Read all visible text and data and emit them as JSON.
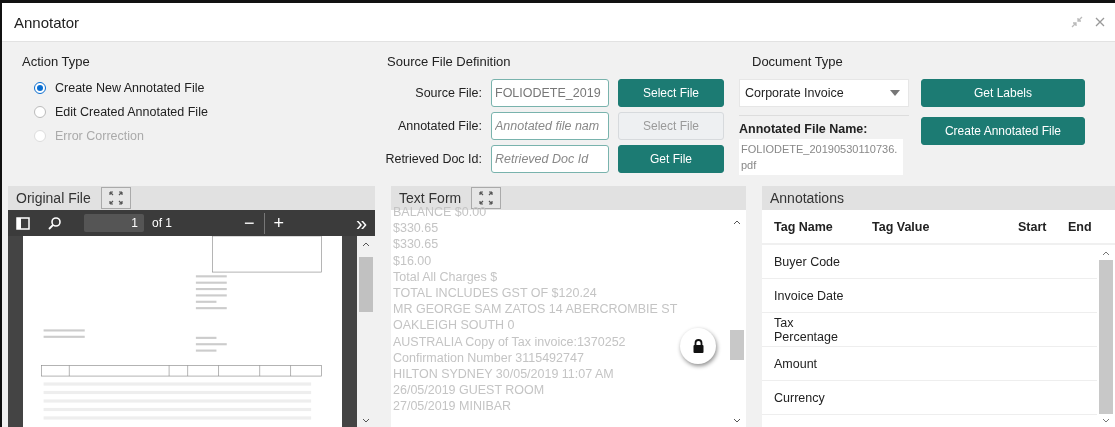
{
  "window": {
    "title": "Annotator"
  },
  "action_type": {
    "title": "Action Type",
    "options": [
      {
        "label": "Create New Annotated File",
        "selected": true,
        "disabled": false
      },
      {
        "label": "Edit Created Annotated File",
        "selected": false,
        "disabled": false
      },
      {
        "label": "Error Correction",
        "selected": false,
        "disabled": true
      }
    ]
  },
  "source_file_definition": {
    "title": "Source File Definition",
    "rows": [
      {
        "label": "Source File:",
        "value": "FOLIODETE_2019",
        "button": {
          "label": "Select File",
          "disabled": false
        }
      },
      {
        "label": "Annotated File:",
        "placeholder": "Annotated file nam",
        "button": {
          "label": "Select File",
          "disabled": true
        }
      },
      {
        "label": "Retrieved Doc Id:",
        "placeholder": "Retrieved Doc Id",
        "button": {
          "label": "Get File",
          "disabled": false
        }
      }
    ]
  },
  "document_type": {
    "title": "Document Type",
    "select": {
      "value": "Corporate Invoice"
    },
    "annotated_file_name": {
      "label": "Annotated File Name:",
      "value": "FOLIODETE_20190530110736.pdf"
    },
    "buttons": [
      "Get Labels",
      "Create Annotated File"
    ]
  },
  "original_file": {
    "title": "Original File",
    "page": "1",
    "page_count": "of 1",
    "zoom_out": "−",
    "zoom_in": "+",
    "more": "»"
  },
  "text_form": {
    "title": "Text Form",
    "lines": [
      "BALANCE $0.00",
      "$330.65",
      "$330.65",
      "$16.00",
      "Total All Charges $",
      "TOTAL INCLUDES GST OF $120.24",
      "MR GEORGE SAM ZATOS 14 ABERCROMBIE ST",
      "OAKLEIGH SOUTH 0",
      "AUSTRALIA Copy of Tax invoice:1370252",
      "Confirmation Number 3115492747",
      "HILTON SYDNEY 30/05/2019 11:07 AM",
      "26/05/2019 GUEST ROOM",
      "27/05/2019 MINIBAR"
    ]
  },
  "annotations": {
    "title": "Annotations",
    "columns": [
      "Tag Name",
      "Tag Value",
      "Start",
      "End"
    ],
    "rows": [
      "Buyer Code",
      "Invoice Date",
      "Tax Percentage",
      "Amount",
      "Currency"
    ]
  }
}
